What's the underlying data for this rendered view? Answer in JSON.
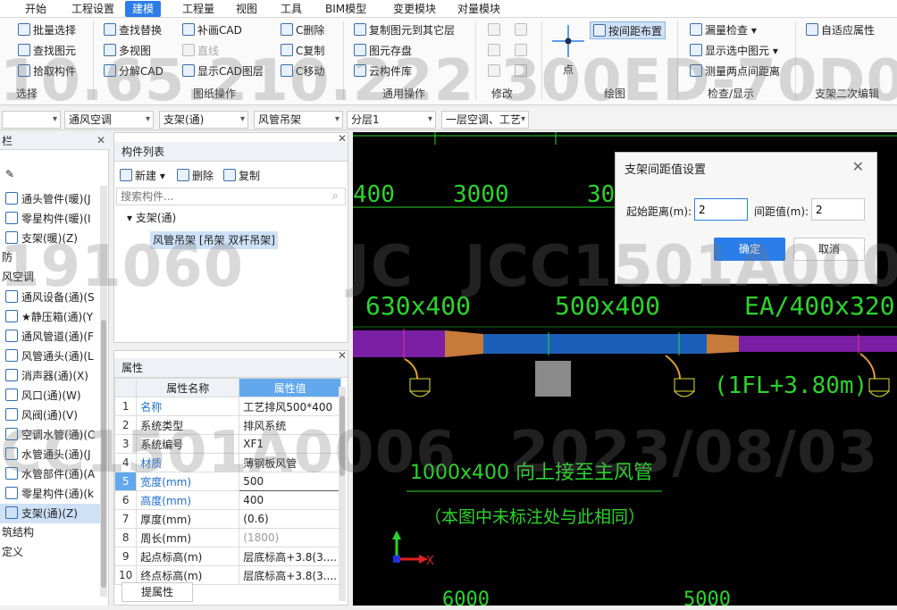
{
  "menu": [
    "开始",
    "工程设置",
    "建模",
    "工程量",
    "视图",
    "工具",
    "BIM模型",
    "变更模块",
    "对量模块"
  ],
  "ribbon": {
    "select": {
      "items": [
        "批量选择",
        "查找图元",
        "拾取构件"
      ],
      "label": "选择"
    },
    "drawing_ops": {
      "items": [
        "查找替换",
        "多视图",
        "分解CAD",
        "补画CAD",
        "直线",
        "显示CAD图层",
        "C删除",
        "C复制",
        "C移动"
      ],
      "label": "图纸操作"
    },
    "general_ops": {
      "items": [
        "复制图元到其它层",
        "图元存盘",
        "云构件库"
      ],
      "label": "通用操作"
    },
    "modify": {
      "label": "修改"
    },
    "draw": {
      "point_label": "点",
      "spacing_layout": "按间距布置",
      "label": "绘图"
    },
    "check": {
      "items": [
        "漏量检查",
        "显示选中图元",
        "测量两点间距离"
      ],
      "label": "检查/显示"
    },
    "support_edit": {
      "items": [
        "自适应属性"
      ],
      "label": "支架二次编辑"
    }
  },
  "filterbar": {
    "system": "通风空调",
    "type": "支架(通)",
    "subtype": "风管吊架",
    "floor": "分层1",
    "scope": "一层空调、工艺"
  },
  "left_panel": {
    "header": "栏",
    "items": [
      {
        "label": "通头管件(暖)(J",
        "icon": "duct-fitting-icon"
      },
      {
        "label": "零星构件(暖)(I",
        "icon": "misc-component-icon"
      },
      {
        "label": "支架(暖)(Z)",
        "icon": "support-icon"
      },
      {
        "label": "防",
        "icon": "",
        "category": true
      },
      {
        "label": "风空调",
        "icon": "",
        "category": true
      },
      {
        "label": "通风设备(通)(S",
        "icon": "fan-icon"
      },
      {
        "label": "★静压箱(通)(Y",
        "icon": "plenum-box-icon"
      },
      {
        "label": "通风管道(通)(F",
        "icon": "duct-icon"
      },
      {
        "label": "风管通头(通)(L",
        "icon": "duct-tee-icon"
      },
      {
        "label": "消声器(通)(X)",
        "icon": "silencer-icon"
      },
      {
        "label": "风口(通)(W)",
        "icon": "air-outlet-icon"
      },
      {
        "label": "风阀(通)(V)",
        "icon": "damper-icon"
      },
      {
        "label": "空调水管(通)(C",
        "icon": "water-pipe-icon"
      },
      {
        "label": "水管通头(通)(J",
        "icon": "pipe-tee-icon"
      },
      {
        "label": "水管部件(通)(A",
        "icon": "valve-icon"
      },
      {
        "label": "零星构件(通)(k",
        "icon": "misc-component-icon"
      },
      {
        "label": "支架(通)(Z)",
        "icon": "support-icon",
        "selected": true
      },
      {
        "label": "筑结构",
        "icon": "",
        "category": true
      },
      {
        "label": "定义",
        "icon": "",
        "category": true
      }
    ]
  },
  "component_list": {
    "title": "构件列表",
    "new": "新建",
    "delete": "删除",
    "copy": "复制",
    "search_placeholder": "搜索构件...",
    "tree_root": "支架(通)",
    "tree_child": "风管吊架 [吊架 双杆吊架]"
  },
  "properties": {
    "title": "属性",
    "col_name": "属性名称",
    "col_value": "属性值",
    "rows": [
      {
        "no": "1",
        "name": "名称",
        "value": "工艺排风500*400",
        "blue": true
      },
      {
        "no": "2",
        "name": "系统类型",
        "value": "排风系统"
      },
      {
        "no": "3",
        "name": "系统编号",
        "value": "XF1"
      },
      {
        "no": "4",
        "name": "材质",
        "value": "薄钢板风管",
        "blue": true
      },
      {
        "no": "5",
        "name": "宽度(mm)",
        "value": "500",
        "blue": true,
        "active": true
      },
      {
        "no": "6",
        "name": "高度(mm)",
        "value": "400",
        "blue": true
      },
      {
        "no": "7",
        "name": "厚度(mm)",
        "value": "(0.6)"
      },
      {
        "no": "8",
        "name": "周长(mm)",
        "value": "(1800)",
        "grey": true
      },
      {
        "no": "9",
        "name": "起点标高(m)",
        "value": "层底标高+3.8(3...."
      },
      {
        "no": "10",
        "name": "终点标高(m)",
        "value": "层底标高+3.8(3...."
      }
    ],
    "bottom_button": "提属性"
  },
  "dialog": {
    "title": "支架间距值设置",
    "start_label": "起始距离(m):",
    "start_value": "2",
    "spacing_label": "间距值(m):",
    "spacing_value": "2",
    "ok": "确定",
    "cancel": "取消"
  },
  "cad": {
    "dims": [
      "400",
      "3000",
      "300",
      "6000",
      "5000"
    ],
    "duct_labels": [
      "630x400",
      "500x400",
      "EA/400x320"
    ],
    "elevation": "(1FL+3.80m)",
    "note1": "1000x400 向上接至主风管",
    "note2": "（本图中未标注处与此相同）",
    "axis_x": "X"
  },
  "watermarks": [
    "10.65.210.222",
    "300ED-70D0D",
    "191060",
    "JC",
    "JCC1501A000",
    "CC1501A0006",
    "2023/08/03"
  ],
  "colors": {
    "accent": "#2b7de9",
    "cad_green": "#2bd42b",
    "duct_purple": "#7a1fa3",
    "duct_blue": "#1c5fb8",
    "duct_orange": "#c87a3a"
  }
}
